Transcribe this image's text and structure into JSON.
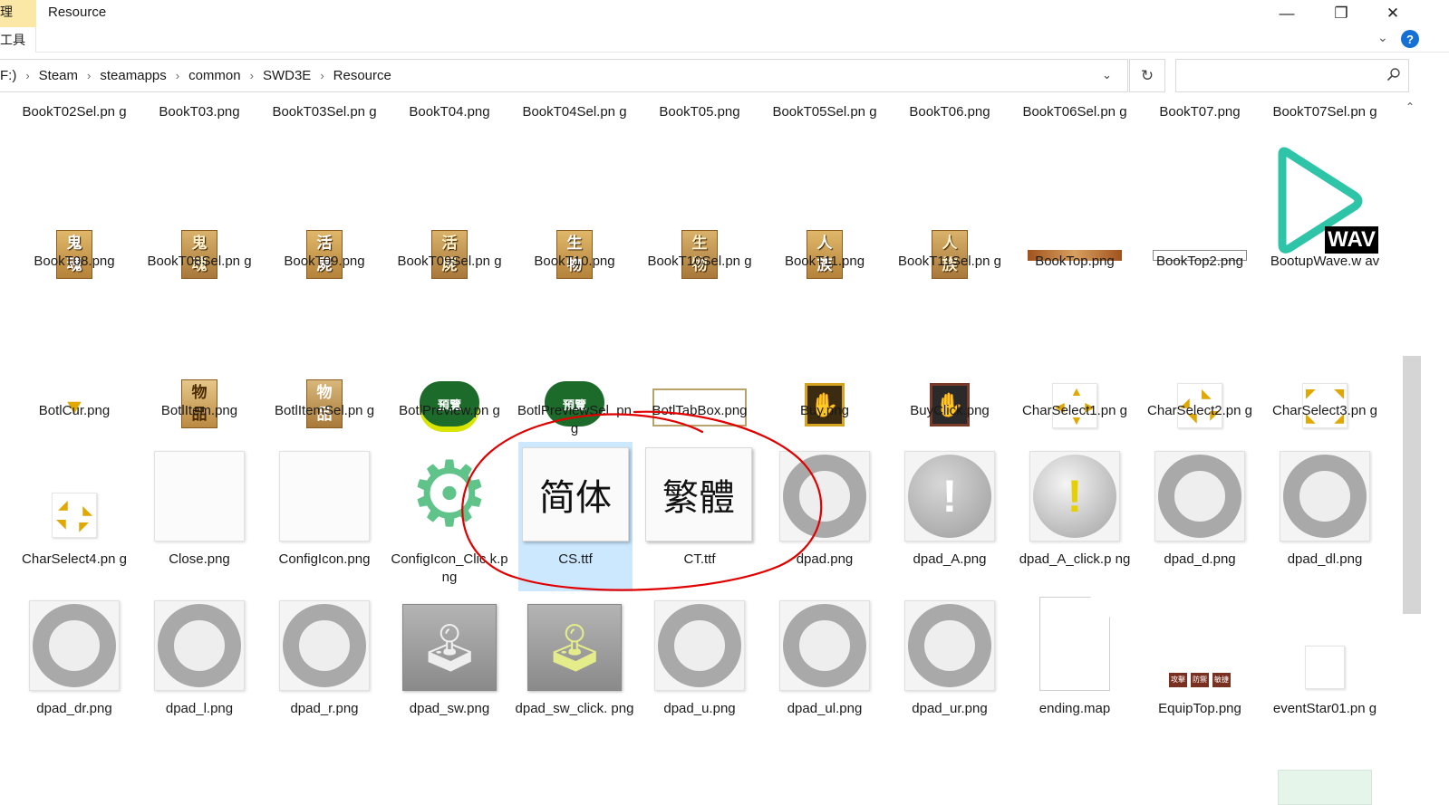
{
  "window": {
    "title": "Resource",
    "title_stub": "理",
    "ribbon_stub": "工具",
    "minimize_glyph": "—",
    "maximize_glyph": "❐",
    "close_glyph": "✕",
    "help_glyph": "?"
  },
  "address": {
    "prefix": "F:)",
    "crumbs": [
      "Steam",
      "steamapps",
      "common",
      "SWD3E",
      "Resource"
    ],
    "separator": "›",
    "search_placeholder": ""
  },
  "files": {
    "row1": [
      "BookT02Sel.pn g",
      "BookT03.png",
      "BookT03Sel.pn g",
      "BookT04.png",
      "BookT04Sel.pn g",
      "BookT05.png",
      "BookT05Sel.pn g",
      "BookT06.png",
      "BookT06Sel.pn g",
      "BookT07.png",
      "BookT07Sel.pn g"
    ],
    "row2": [
      "BookT08.png",
      "BookT08Sel.pn g",
      "BookT09.png",
      "BookT09Sel.pn g",
      "BookT10.png",
      "BookT10Sel.pn g",
      "BookT11.png",
      "BookT11Sel.pn g",
      "BookTop.png",
      "BookTop2.png",
      "BootupWave.w av"
    ],
    "row3": [
      "BotlCur.png",
      "BotlItem.png",
      "BotlItemSel.pn g",
      "BotlPreview.pn g",
      "BotlPreviewSel. png",
      "BotlTabBox.png",
      "Buy.png",
      "BuyClick.png",
      "CharSelect1.pn g",
      "CharSelect2.pn g",
      "CharSelect3.pn g"
    ],
    "row4": [
      "CharSelect4.pn g",
      "Close.png",
      "ConfigIcon.png",
      "ConfigIcon_Clic k.png",
      "CS.ttf",
      "CT.ttf",
      "dpad.png",
      "dpad_A.png",
      "dpad_A_click.p ng",
      "dpad_d.png",
      "dpad_dl.png"
    ],
    "row5": [
      "dpad_dr.png",
      "dpad_l.png",
      "dpad_r.png",
      "dpad_sw.png",
      "dpad_sw_click. png",
      "dpad_u.png",
      "dpad_ul.png",
      "dpad_ur.png",
      "ending.map",
      "EquipTop.png",
      "eventStar01.pn g"
    ]
  },
  "thumb_text": {
    "bookt08": [
      "鬼",
      "魂"
    ],
    "bookt09": [
      "活",
      "屍"
    ],
    "bookt10": [
      "生",
      "物"
    ],
    "bookt11": [
      "人",
      "族"
    ],
    "botlitem": [
      "物",
      "品"
    ],
    "preview": "預覽",
    "cs_font": "简体",
    "ct_font": "繁體",
    "wav_badge": "WAV",
    "equip_tabs": [
      "攻擊",
      "防禦",
      "敏捷"
    ]
  },
  "colors": {
    "selection": "#cce8ff",
    "annotation": "#e00000",
    "help_blue": "#1570d6"
  }
}
